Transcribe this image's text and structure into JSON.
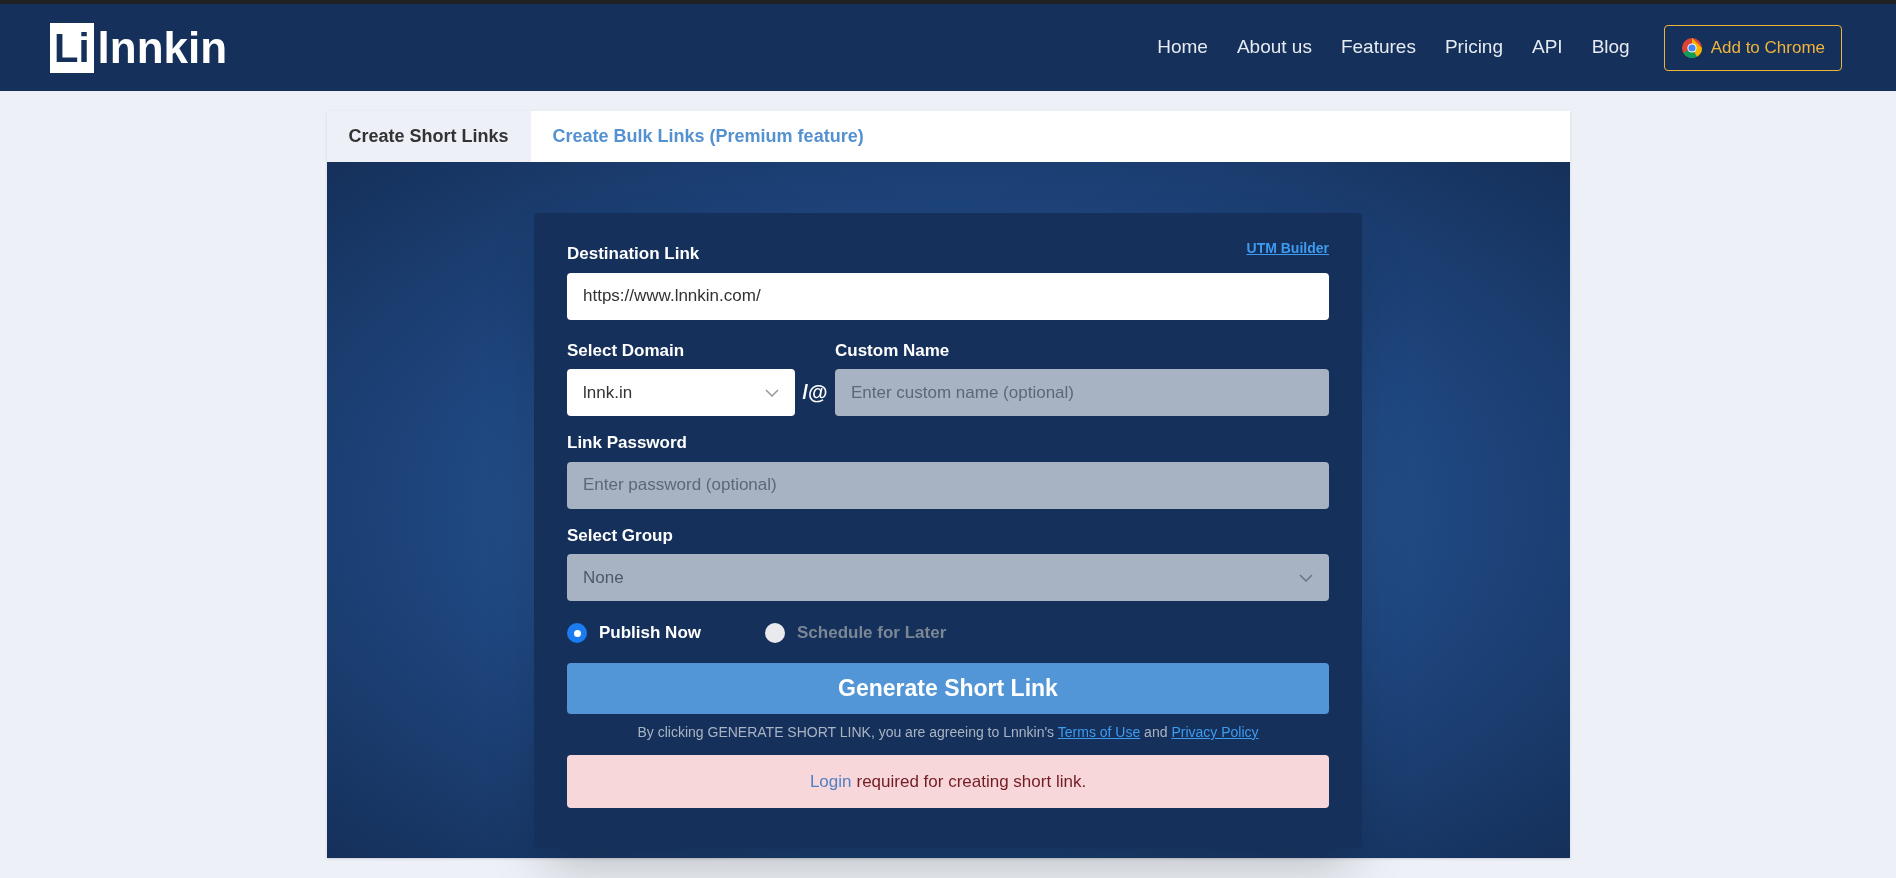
{
  "header": {
    "logo_mark": "Li",
    "logo_text": "lnnkin",
    "nav": [
      "Home",
      "About us",
      "Features",
      "Pricing",
      "API",
      "Blog"
    ],
    "cta": "Add to Chrome"
  },
  "tabs": [
    {
      "label": "Create Short Links",
      "selected": true
    },
    {
      "label": "Create Bulk Links (Premium feature)",
      "selected": false
    }
  ],
  "form": {
    "utm_link": "UTM Builder",
    "destination": {
      "label": "Destination Link",
      "value": "https://www.lnnkin.com/"
    },
    "domain": {
      "label": "Select Domain",
      "value": "lnnk.in"
    },
    "separator": "/@",
    "custom_name": {
      "label": "Custom Name",
      "placeholder": "Enter custom name (optional)"
    },
    "password": {
      "label": "Link Password",
      "placeholder": "Enter password (optional)"
    },
    "group": {
      "label": "Select Group",
      "value": "None"
    },
    "publish_options": [
      {
        "label": "Publish Now",
        "selected": true
      },
      {
        "label": "Schedule for Later",
        "selected": false
      }
    ],
    "submit": "Generate Short Link",
    "terms": {
      "before": "By clicking GENERATE SHORT LINK, you are agreeing to Lnnkin's",
      "terms_link": "Terms of Use",
      "middle": "and",
      "privacy_link": "Privacy Policy"
    },
    "alert": {
      "link": "Login",
      "text": "required for creating short link."
    }
  }
}
